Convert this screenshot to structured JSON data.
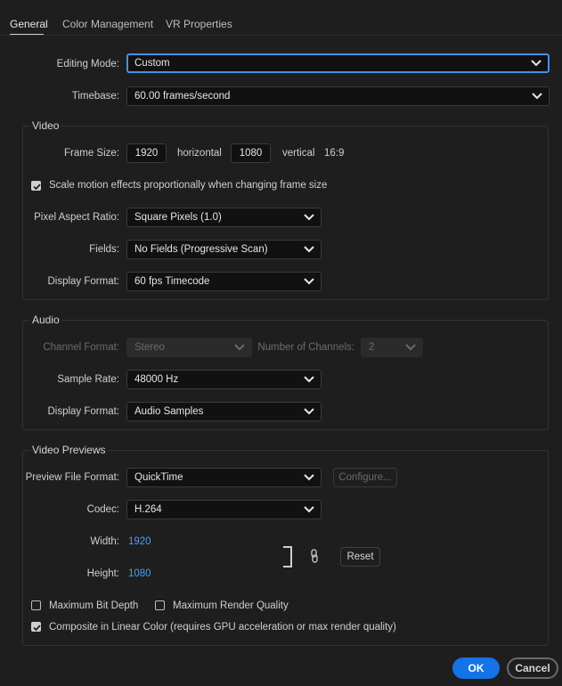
{
  "tabs": [
    "General",
    "Color Management",
    "VR Properties"
  ],
  "general": {
    "editing_mode_label": "Editing Mode:",
    "editing_mode_value": "Custom",
    "timebase_label": "Timebase:",
    "timebase_value": "60.00  frames/second"
  },
  "video": {
    "title": "Video",
    "frame_size_label": "Frame Size:",
    "frame_width": "1920",
    "horizontal_label": "horizontal",
    "frame_height": "1080",
    "vertical_label": "vertical",
    "aspect": "16:9",
    "scale_motion_label": "Scale motion effects proportionally when changing frame size",
    "scale_motion_checked": true,
    "par_label": "Pixel Aspect Ratio:",
    "par_value": "Square Pixels (1.0)",
    "fields_label": "Fields:",
    "fields_value": "No Fields (Progressive Scan)",
    "display_format_label": "Display Format:",
    "display_format_value": "60 fps Timecode"
  },
  "audio": {
    "title": "Audio",
    "channel_format_label": "Channel Format:",
    "channel_format_value": "Stereo",
    "num_channels_label": "Number of Channels:",
    "num_channels_value": "2",
    "sample_rate_label": "Sample Rate:",
    "sample_rate_value": "48000 Hz",
    "display_format_label": "Display Format:",
    "display_format_value": "Audio Samples"
  },
  "previews": {
    "title": "Video Previews",
    "file_format_label": "Preview File Format:",
    "file_format_value": "QuickTime",
    "configure_label": "Configure...",
    "codec_label": "Codec:",
    "codec_value": "H.264",
    "width_label": "Width:",
    "width_value": "1920",
    "height_label": "Height:",
    "height_value": "1080",
    "reset_label": "Reset",
    "max_bit_depth_label": "Maximum Bit Depth",
    "max_bit_depth_checked": false,
    "max_render_quality_label": "Maximum Render Quality",
    "max_render_quality_checked": false,
    "linear_color_label": "Composite in Linear Color (requires GPU acceleration or max render quality)",
    "linear_color_checked": true
  },
  "footer": {
    "ok_label": "OK",
    "cancel_label": "Cancel"
  },
  "colors": {
    "accent": "#1473e6",
    "link_value": "#4a9ff5",
    "background": "#1e1e1e"
  },
  "icons": {
    "dropdown": "chevron-down-icon",
    "link": "link-chain-icon",
    "check": "checkmark-icon"
  }
}
